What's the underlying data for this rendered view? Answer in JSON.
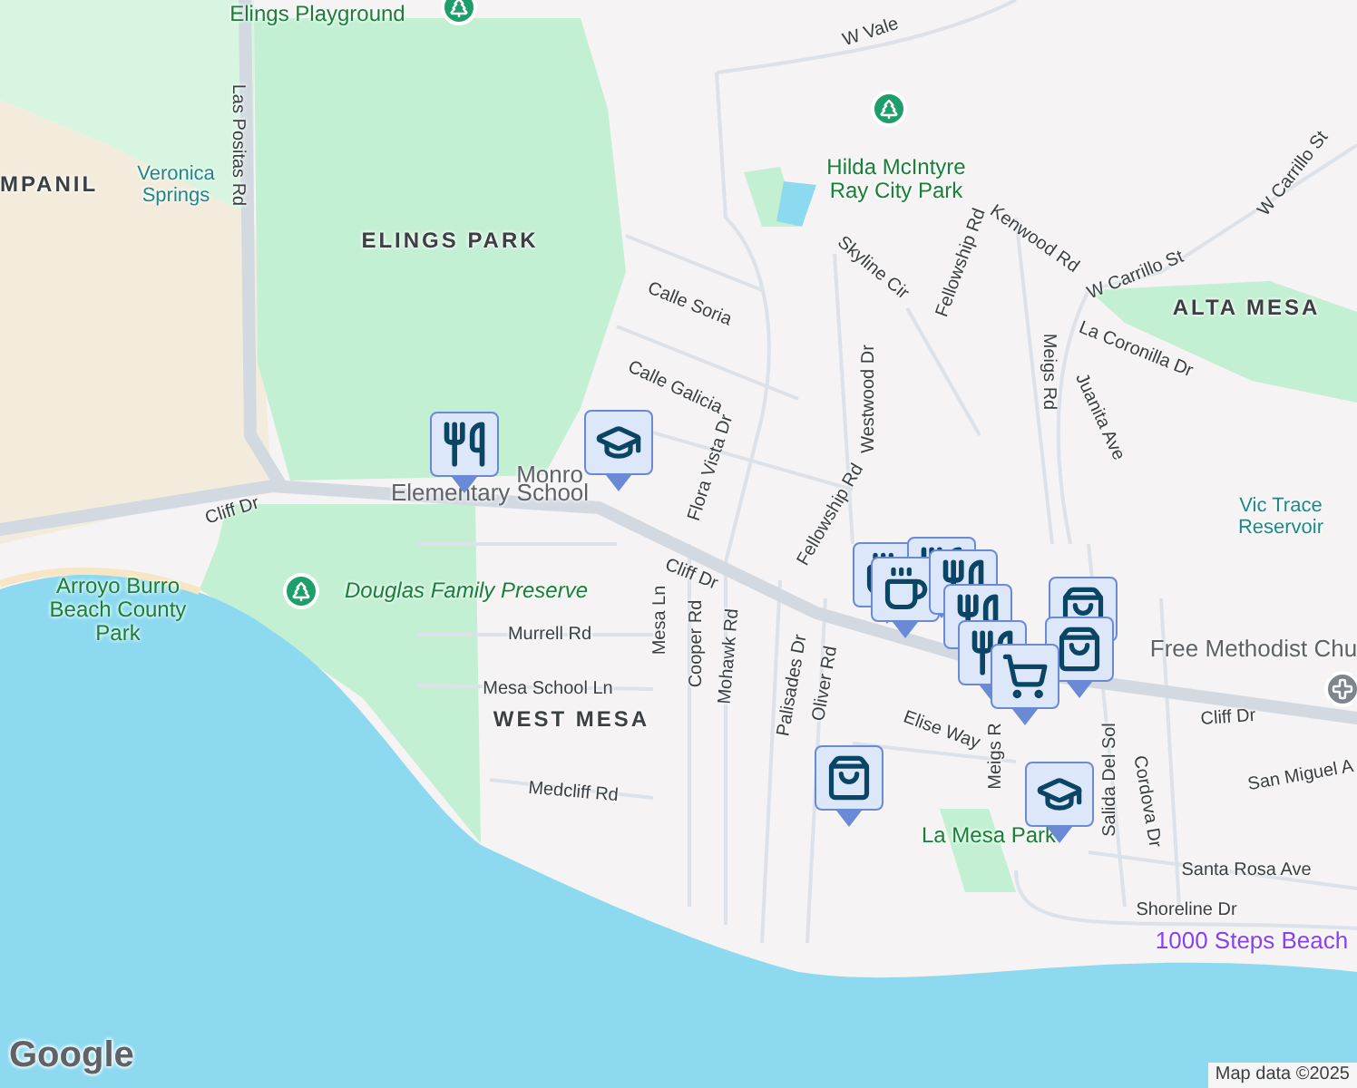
{
  "labels": [
    {
      "text": "Elings Playground",
      "kind": "park"
    },
    {
      "text": "W Vale",
      "kind": "street"
    },
    {
      "text": "MPANIL",
      "kind": "area"
    },
    {
      "text": "Veronica Springs",
      "kind": "water"
    },
    {
      "text": "Las Positas Rd",
      "kind": "street"
    },
    {
      "text": "ELINGS PARK",
      "kind": "area"
    },
    {
      "text": "Calle Soria",
      "kind": "street"
    },
    {
      "text": "Calle Galicia",
      "kind": "street"
    },
    {
      "text": "Hilda McIntyre Ray City Park",
      "kind": "park"
    },
    {
      "text": "Skyline Cir",
      "kind": "street"
    },
    {
      "text": "Fellowship Rd",
      "kind": "street"
    },
    {
      "text": "Kenwood Rd",
      "kind": "street"
    },
    {
      "text": "W Carrillo St",
      "kind": "street"
    },
    {
      "text": "W Carrillo St",
      "kind": "street"
    },
    {
      "text": "ALTA MESA",
      "kind": "area"
    },
    {
      "text": "La Coronilla Dr",
      "kind": "street"
    },
    {
      "text": "Meigs Rd",
      "kind": "street"
    },
    {
      "text": "Juanita Ave",
      "kind": "street"
    },
    {
      "text": "Westwood Dr",
      "kind": "street"
    },
    {
      "text": "Fellowship Rd",
      "kind": "street"
    },
    {
      "text": "Flora Vista Dr",
      "kind": "street"
    },
    {
      "text": "Vic Trace Reservoir",
      "kind": "water"
    },
    {
      "text": "Monro",
      "kind": "poi"
    },
    {
      "text": "Elementary School",
      "kind": "poi"
    },
    {
      "text": "Cliff Dr",
      "kind": "street"
    },
    {
      "text": "Cliff Dr",
      "kind": "street"
    },
    {
      "text": "Cliff Dr",
      "kind": "street"
    },
    {
      "text": "Arroyo Burro Beach County Park",
      "kind": "park"
    },
    {
      "text": "Douglas Family Preserve",
      "kind": "preserve"
    },
    {
      "text": "Murrell Rd",
      "kind": "street"
    },
    {
      "text": "Mesa Ln",
      "kind": "street"
    },
    {
      "text": "Mesa School Ln",
      "kind": "street"
    },
    {
      "text": "WEST MESA",
      "kind": "area"
    },
    {
      "text": "Medcliff Rd",
      "kind": "street"
    },
    {
      "text": "Cooper Rd",
      "kind": "street"
    },
    {
      "text": "Mohawk Rd",
      "kind": "street"
    },
    {
      "text": "Palisades Dr",
      "kind": "street"
    },
    {
      "text": "Oliver Rd",
      "kind": "street"
    },
    {
      "text": "Elise Way",
      "kind": "street"
    },
    {
      "text": "Meigs R",
      "kind": "street"
    },
    {
      "text": "Free Methodist Chu",
      "kind": "poi"
    },
    {
      "text": "Salida Del Sol",
      "kind": "street"
    },
    {
      "text": "Cordova Dr",
      "kind": "street"
    },
    {
      "text": "San Miguel A",
      "kind": "street"
    },
    {
      "text": "Santa Rosa Ave",
      "kind": "street"
    },
    {
      "text": "La Mesa Park",
      "kind": "park"
    },
    {
      "text": "Shoreline Dr",
      "kind": "street"
    },
    {
      "text": "1000 Steps Beach",
      "kind": "beach"
    }
  ],
  "markers": [
    {
      "kind": "park"
    },
    {
      "kind": "park"
    },
    {
      "kind": "park"
    },
    {
      "kind": "church"
    }
  ],
  "pins": [
    {
      "kind": "restaurant"
    },
    {
      "kind": "school"
    },
    {
      "kind": "coffee"
    },
    {
      "kind": "restaurant"
    },
    {
      "kind": "coffee"
    },
    {
      "kind": "restaurant"
    },
    {
      "kind": "restaurant"
    },
    {
      "kind": "shopping"
    },
    {
      "kind": "restaurant"
    },
    {
      "kind": "shopping"
    },
    {
      "kind": "cart"
    },
    {
      "kind": "shopping"
    },
    {
      "kind": "school"
    }
  ],
  "attribution": {
    "logo": "Google",
    "text": "Map data ©2025"
  }
}
